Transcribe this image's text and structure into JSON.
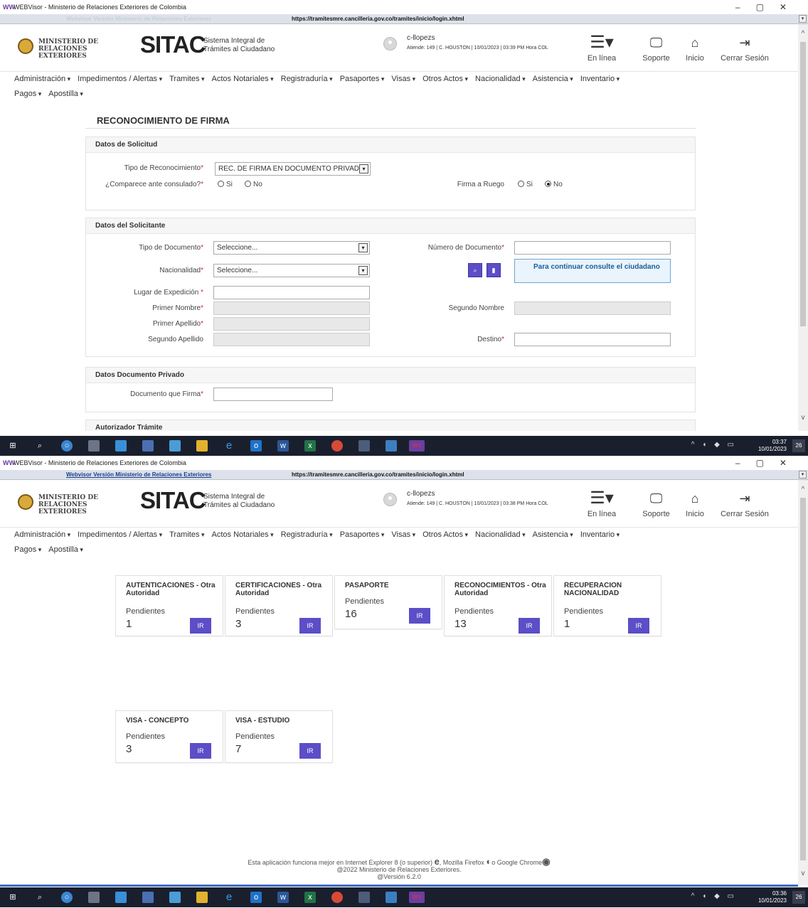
{
  "window": {
    "app_letters": "WW",
    "title": "WEBVisor - Ministerio de Relaciones Exteriores de Colombia",
    "webvisor_link": "Webvisor Versión Ministerio de Relaciones Exteriores",
    "url": "https://tramitesmre.cancilleria.gov.co/tramites/inicio/login.xhtml"
  },
  "header": {
    "ministry": "MINISTERIO DE RELACIONES EXTERIORES",
    "logo": "SITAC",
    "logo_sub_1": "Sistema Integral de",
    "logo_sub_2": "Trámites al Ciudadano",
    "username": "c-llopezs",
    "attends_1": "Atiende: 149 | C. HOUSTON | 10/01/2023 | 03:39 PM Hora COL",
    "attends_2": "Atiende: 149 | C. HOUSTON | 10/01/2023 | 03:38 PM Hora COL",
    "status": "En línea",
    "support": "Soporte",
    "home": "Inicio",
    "logout": "Cerrar Sesión",
    "icons": {
      "menu": "hamburger-icon",
      "support": "monitor-support-icon",
      "home": "home-icon",
      "logout": "logout-icon"
    }
  },
  "menu": {
    "row1": [
      "Administración",
      "Impedimentos / Alertas",
      "Tramites",
      "Actos Notariales",
      "Registraduría",
      "Pasaportes",
      "Visas",
      "Otros Actos",
      "Nacionalidad",
      "Asistencia",
      "Inventario"
    ],
    "row2": [
      "Pagos",
      "Apostilla"
    ]
  },
  "form": {
    "title": "RECONOCIMIENTO DE FIRMA",
    "solicitud": {
      "heading": "Datos de Solicitud",
      "tipo_label": "Tipo de Reconocimiento",
      "tipo_value": "REC. DE FIRMA EN DOCUMENTO PRIVADO",
      "comparece_label": "¿Comparece ante consulado?",
      "si": "Si",
      "no": "No",
      "ruego_label": "Firma a Ruego",
      "ruego_selected": "No"
    },
    "solicitante": {
      "heading": "Datos del Solicitante",
      "tipo_doc_label": "Tipo de Documento",
      "tipo_doc_value": "Seleccione...",
      "nacionalidad_label": "Nacionalidad",
      "nacionalidad_value": "Seleccione...",
      "numero_doc_label": "Número de Documento",
      "search_icon": "search-icon",
      "delete_icon": "trash-icon",
      "note": "Para continuar consulte el ciudadano",
      "lugar_label": "Lugar de Expedición",
      "primer_nombre_label": "Primer Nombre",
      "segundo_nombre_label": "Segundo Nombre",
      "primer_apellido_label": "Primer Apellido",
      "segundo_apellido_label": "Segundo Apellido",
      "destino_label": "Destino"
    },
    "privado": {
      "heading": "Datos Documento Privado",
      "doc_label": "Documento que Firma"
    },
    "autorizador": {
      "heading": "Autorizador Trámite"
    }
  },
  "dashboard": {
    "cards": [
      {
        "title": "AUTENTICACIONES - Otra Autoridad",
        "label": "Pendientes",
        "count": "1",
        "button": "IR"
      },
      {
        "title": "CERTIFICACIONES - Otra Autoridad",
        "label": "Pendientes",
        "count": "3",
        "button": "IR"
      },
      {
        "title": "PASAPORTE",
        "label": "Pendientes",
        "count": "16",
        "button": "IR"
      },
      {
        "title": "RECONOCIMIENTOS - Otra Autoridad",
        "label": "Pendientes",
        "count": "13",
        "button": "IR"
      },
      {
        "title": "RECUPERACION NACIONALIDAD",
        "label": "Pendientes",
        "count": "1",
        "button": "IR"
      },
      {
        "title": "VISA - CONCEPTO",
        "label": "Pendientes",
        "count": "3",
        "button": "IR"
      },
      {
        "title": "VISA - ESTUDIO",
        "label": "Pendientes",
        "count": "7",
        "button": "IR"
      }
    ]
  },
  "footer": {
    "line1a": "Esta aplicación funciona mejor en Internet Explorer 8 (o superior)",
    "line1b": ", Mozilla Firefox",
    "line1c": "o Google Chrome",
    "line2": "@2022 Ministerio de Relaciones Exteriores.",
    "line3": "@Versión 6.2.0"
  },
  "taskbar": {
    "time_1": "03:37",
    "time_2": "03:36",
    "date": "10/01/2023",
    "notifications": "26",
    "app_badge": "WV"
  },
  "colors": {
    "accent": "#5b4ec7",
    "note_bg": "#e9f4fc",
    "required": "#d9232a",
    "taskbar": "#1a1f2e"
  }
}
